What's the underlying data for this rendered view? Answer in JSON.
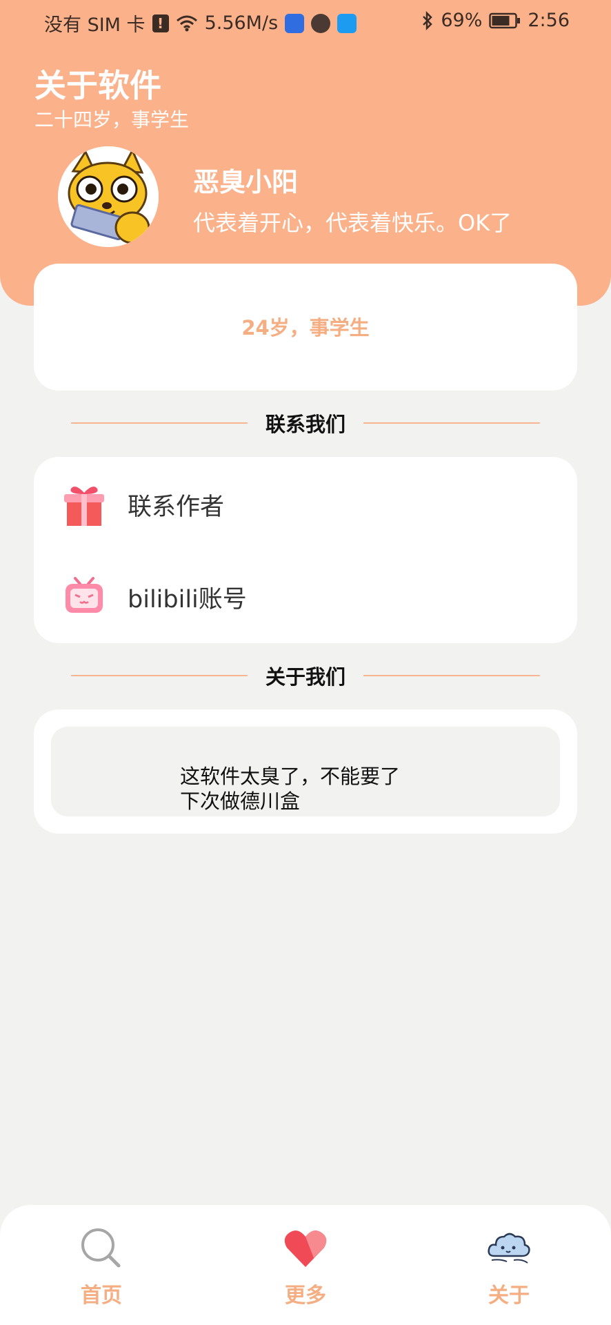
{
  "status_bar": {
    "carrier": "没有 SIM 卡",
    "alert_badge": "!",
    "speed": "5.56M/s",
    "battery": "69%",
    "time": "2:56"
  },
  "header": {
    "title": "关于软件",
    "subtitle": "二十四岁，事学生",
    "user_name": "恶臭小阳",
    "user_motto": "代表着开心，代表着快乐。OK了"
  },
  "intro_card": {
    "text": "24岁，事学生"
  },
  "contact_section": {
    "title": "联系我们",
    "items": [
      {
        "label": "联系作者",
        "icon": "gift-icon"
      },
      {
        "label": "bilibili账号",
        "icon": "bilibili-tv-icon"
      }
    ]
  },
  "about_section": {
    "title": "关于我们",
    "lines": [
      "这软件太臭了，不能要了",
      "下次做德川盒"
    ]
  },
  "bottom_nav": {
    "items": [
      {
        "label": "首页",
        "icon": "search-icon"
      },
      {
        "label": "更多",
        "icon": "heart-icon"
      },
      {
        "label": "关于",
        "icon": "cloud-icon"
      }
    ]
  },
  "colors": {
    "accent": "#fbb18a",
    "accent_text": "#f5ad82",
    "background": "#f2f2f0"
  }
}
